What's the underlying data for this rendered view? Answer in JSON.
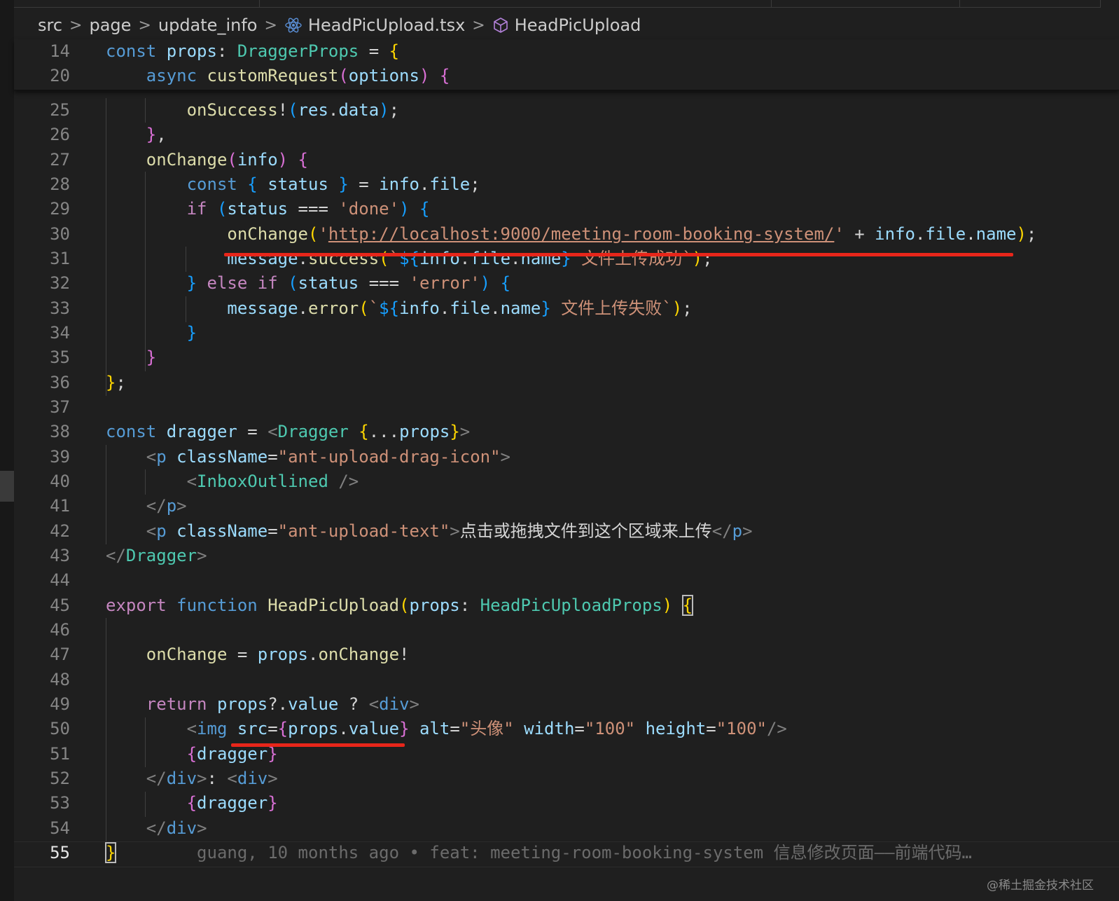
{
  "breadcrumb": {
    "items": [
      "src",
      "page",
      "update_info",
      "HeadPicUpload.tsx",
      "HeadPicUpload"
    ],
    "separator": ">",
    "file_icon": "react-icon",
    "symbol_icon": "cube-icon"
  },
  "sticky": {
    "lines": [
      {
        "num": "14",
        "tokens": [
          [
            "k",
            "const"
          ],
          [
            "p",
            " "
          ],
          [
            "v",
            "props"
          ],
          [
            "p",
            ": "
          ],
          [
            "ty",
            "DraggerProps"
          ],
          [
            "p",
            " = "
          ],
          [
            "b1",
            "{"
          ]
        ]
      },
      {
        "num": "20",
        "tokens": [
          [
            "p",
            "    "
          ],
          [
            "k",
            "async"
          ],
          [
            "p",
            " "
          ],
          [
            "fn",
            "customRequest"
          ],
          [
            "b2",
            "("
          ],
          [
            "v",
            "options"
          ],
          [
            "b2",
            ")"
          ],
          [
            "p",
            " "
          ],
          [
            "b2",
            "{"
          ]
        ]
      }
    ]
  },
  "code": {
    "lines": [
      {
        "num": "25",
        "tokens": [
          [
            "p",
            "        "
          ],
          [
            "fn",
            "onSuccess"
          ],
          [
            "p",
            "!"
          ],
          [
            "b3",
            "("
          ],
          [
            "v",
            "res"
          ],
          [
            "p",
            "."
          ],
          [
            "v",
            "data"
          ],
          [
            "b3",
            ")"
          ],
          [
            "p",
            ";"
          ]
        ]
      },
      {
        "num": "26",
        "tokens": [
          [
            "p",
            "    "
          ],
          [
            "b2",
            "}"
          ],
          [
            "p",
            ","
          ]
        ]
      },
      {
        "num": "27",
        "tokens": [
          [
            "p",
            "    "
          ],
          [
            "fn",
            "onChange"
          ],
          [
            "b2",
            "("
          ],
          [
            "v",
            "info"
          ],
          [
            "b2",
            ")"
          ],
          [
            "p",
            " "
          ],
          [
            "b2",
            "{"
          ]
        ]
      },
      {
        "num": "28",
        "tokens": [
          [
            "p",
            "        "
          ],
          [
            "k",
            "const"
          ],
          [
            "p",
            " "
          ],
          [
            "b3",
            "{"
          ],
          [
            "p",
            " "
          ],
          [
            "v",
            "status"
          ],
          [
            "p",
            " "
          ],
          [
            "b3",
            "}"
          ],
          [
            "p",
            " = "
          ],
          [
            "v",
            "info"
          ],
          [
            "p",
            "."
          ],
          [
            "v",
            "file"
          ],
          [
            "p",
            ";"
          ]
        ]
      },
      {
        "num": "29",
        "tokens": [
          [
            "p",
            "        "
          ],
          [
            "kc",
            "if"
          ],
          [
            "p",
            " "
          ],
          [
            "b3",
            "("
          ],
          [
            "v",
            "status"
          ],
          [
            "p",
            " === "
          ],
          [
            "s",
            "'done'"
          ],
          [
            "b3",
            ")"
          ],
          [
            "p",
            " "
          ],
          [
            "b3",
            "{"
          ]
        ]
      },
      {
        "num": "30",
        "tokens": [
          [
            "p",
            "            "
          ],
          [
            "fn",
            "onChange"
          ],
          [
            "b1",
            "("
          ],
          [
            "s",
            "'"
          ],
          [
            "su",
            "http://localhost:9000/meeting-room-booking-system/"
          ],
          [
            "s",
            "'"
          ],
          [
            "p",
            " + "
          ],
          [
            "v",
            "info"
          ],
          [
            "p",
            "."
          ],
          [
            "v",
            "file"
          ],
          [
            "p",
            "."
          ],
          [
            "v",
            "name"
          ],
          [
            "b1",
            ")"
          ],
          [
            "p",
            ";"
          ]
        ]
      },
      {
        "num": "31",
        "tokens": [
          [
            "p",
            "            "
          ],
          [
            "v",
            "message"
          ],
          [
            "p",
            "."
          ],
          [
            "fn",
            "success"
          ],
          [
            "b1",
            "("
          ],
          [
            "s",
            "`"
          ],
          [
            "b3",
            "${"
          ],
          [
            "v",
            "info"
          ],
          [
            "p",
            "."
          ],
          [
            "v",
            "file"
          ],
          [
            "p",
            "."
          ],
          [
            "v",
            "name"
          ],
          [
            "b3",
            "}"
          ],
          [
            "s",
            " 文件上传成功`"
          ],
          [
            "b1",
            ")"
          ],
          [
            "p",
            ";"
          ]
        ]
      },
      {
        "num": "32",
        "tokens": [
          [
            "p",
            "        "
          ],
          [
            "b3",
            "}"
          ],
          [
            "p",
            " "
          ],
          [
            "kc",
            "else"
          ],
          [
            "p",
            " "
          ],
          [
            "kc",
            "if"
          ],
          [
            "p",
            " "
          ],
          [
            "b3",
            "("
          ],
          [
            "v",
            "status"
          ],
          [
            "p",
            " === "
          ],
          [
            "s",
            "'error'"
          ],
          [
            "b3",
            ")"
          ],
          [
            "p",
            " "
          ],
          [
            "b3",
            "{"
          ]
        ]
      },
      {
        "num": "33",
        "tokens": [
          [
            "p",
            "            "
          ],
          [
            "v",
            "message"
          ],
          [
            "p",
            "."
          ],
          [
            "fn",
            "error"
          ],
          [
            "b1",
            "("
          ],
          [
            "s",
            "`"
          ],
          [
            "b3",
            "${"
          ],
          [
            "v",
            "info"
          ],
          [
            "p",
            "."
          ],
          [
            "v",
            "file"
          ],
          [
            "p",
            "."
          ],
          [
            "v",
            "name"
          ],
          [
            "b3",
            "}"
          ],
          [
            "s",
            " 文件上传失败`"
          ],
          [
            "b1",
            ")"
          ],
          [
            "p",
            ";"
          ]
        ]
      },
      {
        "num": "34",
        "tokens": [
          [
            "p",
            "        "
          ],
          [
            "b3",
            "}"
          ]
        ]
      },
      {
        "num": "35",
        "tokens": [
          [
            "p",
            "    "
          ],
          [
            "b2",
            "}"
          ]
        ]
      },
      {
        "num": "36",
        "tokens": [
          [
            "b1",
            "}"
          ],
          [
            "p",
            ";"
          ]
        ]
      },
      {
        "num": "37",
        "tokens": []
      },
      {
        "num": "38",
        "tokens": [
          [
            "k",
            "const"
          ],
          [
            "p",
            " "
          ],
          [
            "v",
            "dragger"
          ],
          [
            "p",
            " = "
          ],
          [
            "tg",
            "<"
          ],
          [
            "ty",
            "Dragger"
          ],
          [
            "p",
            " "
          ],
          [
            "b1",
            "{"
          ],
          [
            "p",
            "..."
          ],
          [
            "v",
            "props"
          ],
          [
            "b1",
            "}"
          ],
          [
            "tg",
            ">"
          ]
        ]
      },
      {
        "num": "39",
        "tokens": [
          [
            "p",
            "    "
          ],
          [
            "tg",
            "<"
          ],
          [
            "k",
            "p"
          ],
          [
            "p",
            " "
          ],
          [
            "v",
            "className"
          ],
          [
            "p",
            "="
          ],
          [
            "s",
            "\"ant-upload-drag-icon\""
          ],
          [
            "tg",
            ">"
          ]
        ]
      },
      {
        "num": "40",
        "tokens": [
          [
            "p",
            "        "
          ],
          [
            "tg",
            "<"
          ],
          [
            "ty",
            "InboxOutlined"
          ],
          [
            "p",
            " "
          ],
          [
            "tg",
            "/>"
          ]
        ]
      },
      {
        "num": "41",
        "tokens": [
          [
            "p",
            "    "
          ],
          [
            "tg",
            "</"
          ],
          [
            "k",
            "p"
          ],
          [
            "tg",
            ">"
          ]
        ]
      },
      {
        "num": "42",
        "tokens": [
          [
            "p",
            "    "
          ],
          [
            "tg",
            "<"
          ],
          [
            "k",
            "p"
          ],
          [
            "p",
            " "
          ],
          [
            "v",
            "className"
          ],
          [
            "p",
            "="
          ],
          [
            "s",
            "\"ant-upload-text\""
          ],
          [
            "tg",
            ">"
          ],
          [
            "p",
            "点击或拖拽文件到这个区域来上传"
          ],
          [
            "tg",
            "</"
          ],
          [
            "k",
            "p"
          ],
          [
            "tg",
            ">"
          ]
        ]
      },
      {
        "num": "43",
        "tokens": [
          [
            "tg",
            "</"
          ],
          [
            "ty",
            "Dragger"
          ],
          [
            "tg",
            ">"
          ]
        ]
      },
      {
        "num": "44",
        "tokens": []
      },
      {
        "num": "45",
        "tokens": [
          [
            "kc",
            "export"
          ],
          [
            "p",
            " "
          ],
          [
            "k",
            "function"
          ],
          [
            "p",
            " "
          ],
          [
            "fn",
            "HeadPicUpload"
          ],
          [
            "b1",
            "("
          ],
          [
            "v",
            "props"
          ],
          [
            "p",
            ": "
          ],
          [
            "ty",
            "HeadPicUploadProps"
          ],
          [
            "b1",
            ")"
          ],
          [
            "p",
            " "
          ],
          [
            "bcur",
            "{"
          ]
        ]
      },
      {
        "num": "46",
        "tokens": []
      },
      {
        "num": "47",
        "tokens": [
          [
            "p",
            "    "
          ],
          [
            "fn",
            "onChange"
          ],
          [
            "p",
            " = "
          ],
          [
            "v",
            "props"
          ],
          [
            "p",
            "."
          ],
          [
            "fn",
            "onChange"
          ],
          [
            "p",
            "!"
          ]
        ]
      },
      {
        "num": "48",
        "tokens": []
      },
      {
        "num": "49",
        "tokens": [
          [
            "p",
            "    "
          ],
          [
            "kc",
            "return"
          ],
          [
            "p",
            " "
          ],
          [
            "v",
            "props"
          ],
          [
            "p",
            "?."
          ],
          [
            "v",
            "value"
          ],
          [
            "p",
            " ? "
          ],
          [
            "tg",
            "<"
          ],
          [
            "k",
            "div"
          ],
          [
            "tg",
            ">"
          ]
        ]
      },
      {
        "num": "50",
        "tokens": [
          [
            "p",
            "        "
          ],
          [
            "tg",
            "<"
          ],
          [
            "k",
            "img"
          ],
          [
            "p",
            " "
          ],
          [
            "v",
            "src"
          ],
          [
            "p",
            "="
          ],
          [
            "b2",
            "{"
          ],
          [
            "v",
            "props"
          ],
          [
            "p",
            "."
          ],
          [
            "v",
            "value"
          ],
          [
            "b2",
            "}"
          ],
          [
            "p",
            " "
          ],
          [
            "v",
            "alt"
          ],
          [
            "p",
            "="
          ],
          [
            "s",
            "\"头像\""
          ],
          [
            "p",
            " "
          ],
          [
            "v",
            "width"
          ],
          [
            "p",
            "="
          ],
          [
            "s",
            "\"100\""
          ],
          [
            "p",
            " "
          ],
          [
            "v",
            "height"
          ],
          [
            "p",
            "="
          ],
          [
            "s",
            "\"100\""
          ],
          [
            "tg",
            "/>"
          ]
        ]
      },
      {
        "num": "51",
        "tokens": [
          [
            "p",
            "        "
          ],
          [
            "b2",
            "{"
          ],
          [
            "v",
            "dragger"
          ],
          [
            "b2",
            "}"
          ]
        ]
      },
      {
        "num": "52",
        "tokens": [
          [
            "p",
            "    "
          ],
          [
            "tg",
            "</"
          ],
          [
            "k",
            "div"
          ],
          [
            "tg",
            ">"
          ],
          [
            "p",
            ": "
          ],
          [
            "tg",
            "<"
          ],
          [
            "k",
            "div"
          ],
          [
            "tg",
            ">"
          ]
        ]
      },
      {
        "num": "53",
        "tokens": [
          [
            "p",
            "        "
          ],
          [
            "b2",
            "{"
          ],
          [
            "v",
            "dragger"
          ],
          [
            "b2",
            "}"
          ]
        ]
      },
      {
        "num": "54",
        "tokens": [
          [
            "p",
            "    "
          ],
          [
            "tg",
            "</"
          ],
          [
            "k",
            "div"
          ],
          [
            "tg",
            ">"
          ]
        ]
      },
      {
        "num": "55",
        "tokens": [
          [
            "bcur",
            "}"
          ],
          [
            "p",
            "        "
          ],
          [
            "blame",
            "guang, 10 months ago • feat: meeting-room-booking-system 信息修改页面——前端代码…"
          ]
        ]
      }
    ],
    "current_line": "55"
  },
  "watermark": "@稀土掘金技术社区",
  "colors": {
    "background": "#1f1f1f",
    "keyword": "#569cd6",
    "control": "#c586c0",
    "function": "#dcdcaa",
    "variable": "#9cdcfe",
    "type": "#4ec9b0",
    "string": "#ce9178",
    "annotation_underline": "#e8261a"
  }
}
